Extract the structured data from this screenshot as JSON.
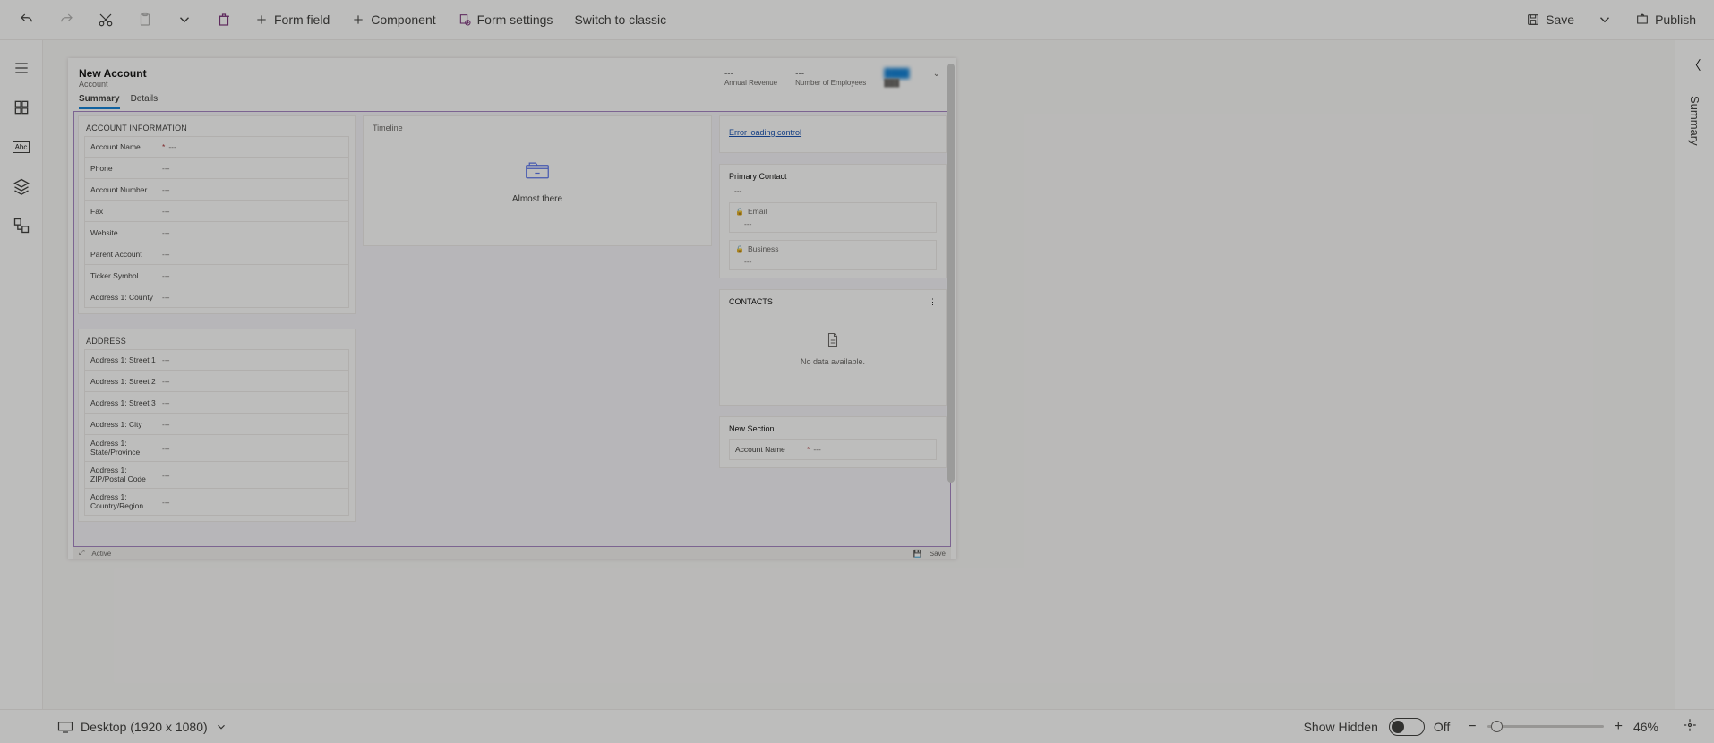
{
  "toolbar": {
    "form_field": "Form field",
    "component": "Component",
    "form_settings": "Form settings",
    "switch_classic": "Switch to classic",
    "save": "Save",
    "publish": "Publish"
  },
  "right_panel": {
    "label": "Summary"
  },
  "form": {
    "title": "New Account",
    "entity": "Account",
    "metrics": {
      "annual_rev_val": "---",
      "annual_rev_lab": "Annual Revenue",
      "employees_val": "---",
      "employees_lab": "Number of Employees"
    },
    "tabs": {
      "summary": "Summary",
      "details": "Details"
    },
    "section_account_info": "ACCOUNT INFORMATION",
    "account_fields": [
      {
        "label": "Account Name",
        "value": "---",
        "required": true
      },
      {
        "label": "Phone",
        "value": "---"
      },
      {
        "label": "Account Number",
        "value": "---"
      },
      {
        "label": "Fax",
        "value": "---"
      },
      {
        "label": "Website",
        "value": "---"
      },
      {
        "label": "Parent Account",
        "value": "---"
      },
      {
        "label": "Ticker Symbol",
        "value": "---"
      },
      {
        "label": "Address 1: County",
        "value": "---"
      }
    ],
    "section_address": "ADDRESS",
    "address_fields": [
      {
        "label": "Address 1: Street 1",
        "value": "---"
      },
      {
        "label": "Address 1: Street 2",
        "value": "---"
      },
      {
        "label": "Address 1: Street 3",
        "value": "---"
      },
      {
        "label": "Address 1: City",
        "value": "---"
      },
      {
        "label": "Address 1: State/Province",
        "value": "---",
        "tall": true
      },
      {
        "label": "Address 1: ZIP/Postal Code",
        "value": "---",
        "tall": true
      },
      {
        "label": "Address 1: Country/Region",
        "value": "---",
        "tall": true
      }
    ],
    "timeline_label": "Timeline",
    "timeline_msg": "Almost there",
    "error_link": "Error loading control",
    "primary_contact": "Primary Contact",
    "primary_contact_val": "---",
    "email_label": "Email",
    "email_val": "---",
    "business_label": "Business",
    "business_val": "---",
    "contacts_label": "CONTACTS",
    "no_data": "No data available.",
    "new_section": "New Section",
    "new_section_field_label": "Account Name",
    "new_section_field_val": "---",
    "footer_active": "Active",
    "footer_save": "Save"
  },
  "bottom": {
    "device": "Desktop (1920 x 1080)",
    "show_hidden": "Show Hidden",
    "toggle_state": "Off",
    "zoom": "46%"
  }
}
